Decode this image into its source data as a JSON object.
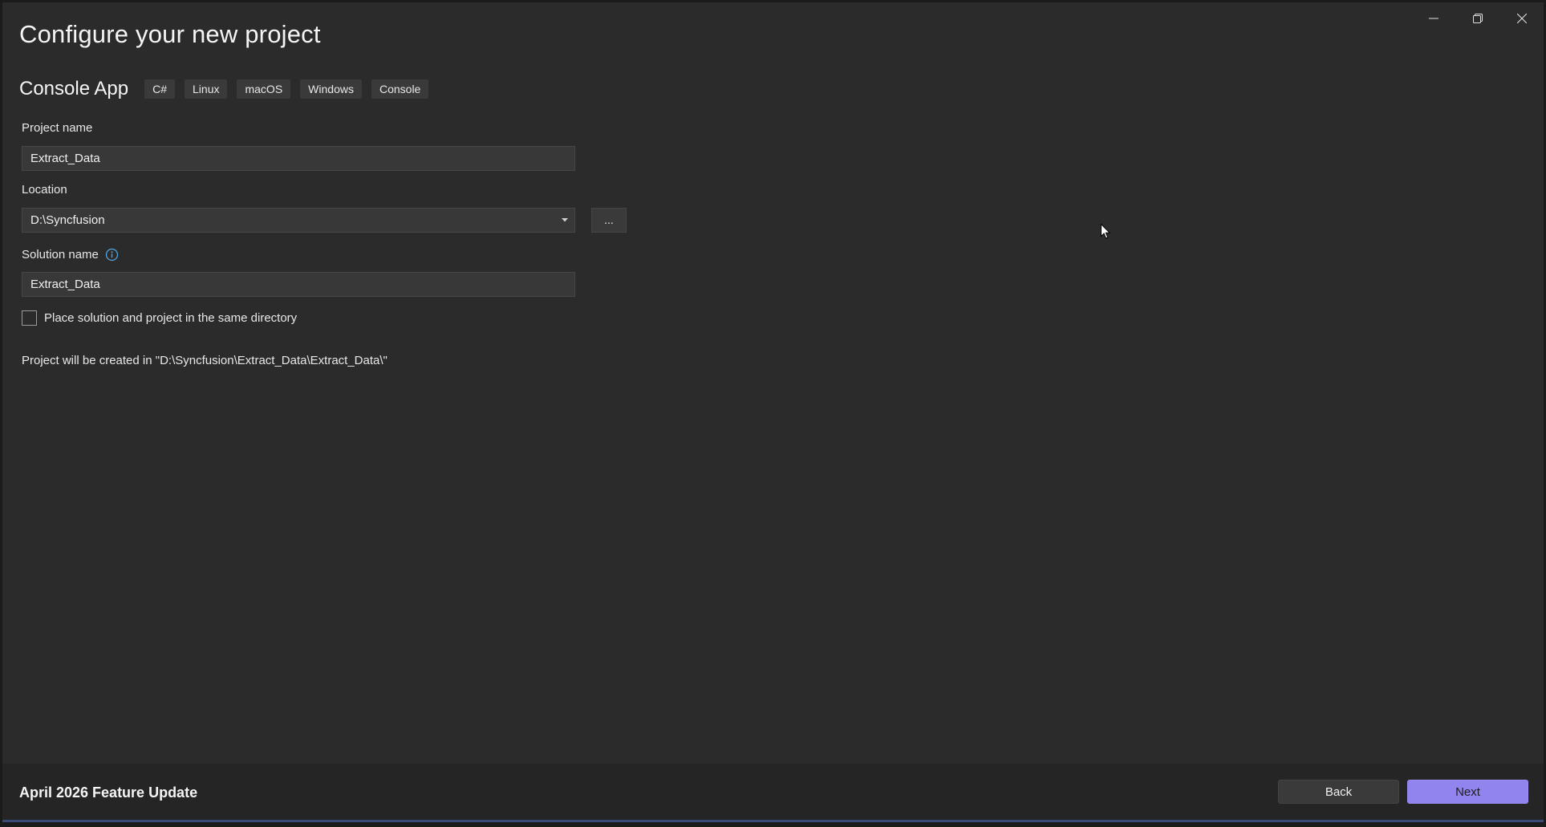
{
  "window": {
    "controls": {
      "minimize_icon": "minimize-icon",
      "restore_icon": "restore-icon",
      "close_icon": "close-icon"
    }
  },
  "page": {
    "title": "Configure your new project"
  },
  "template": {
    "name": "Console App",
    "tags": [
      "C#",
      "Linux",
      "macOS",
      "Windows",
      "Console"
    ]
  },
  "form": {
    "project_name": {
      "label": "Project name",
      "value": "Extract_Data"
    },
    "location": {
      "label": "Location",
      "value": "D:\\Syncfusion",
      "browse_label": "..."
    },
    "solution_name": {
      "label": "Solution name",
      "value": "Extract_Data",
      "info_icon": "info-icon"
    },
    "same_directory": {
      "label": "Place solution and project in the same directory",
      "checked": false
    },
    "created_path": "Project will be created in \"D:\\Syncfusion\\Extract_Data\\Extract_Data\\\""
  },
  "footer": {
    "title": "April 2026 Feature Update",
    "back_label": "Back",
    "next_label": "Next"
  },
  "colors": {
    "background": "#2b2b2b",
    "accent": "#9184ee",
    "info": "#4fa3e0"
  }
}
